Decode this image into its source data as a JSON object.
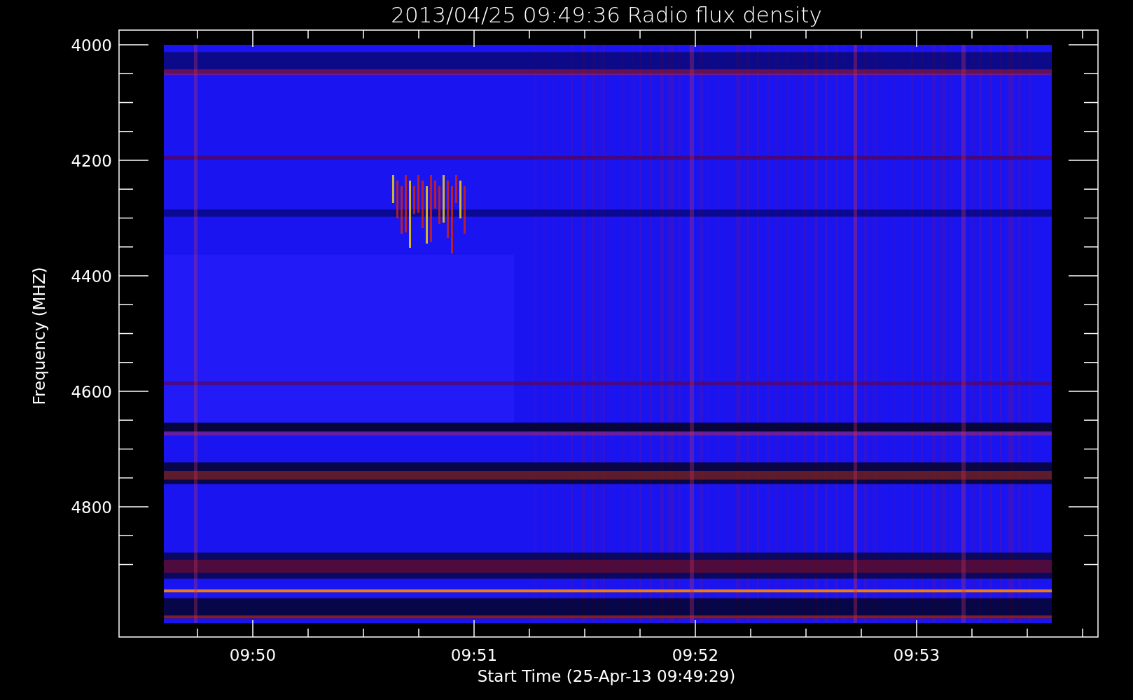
{
  "title": "2013/04/25 09:49:36 Radio flux density",
  "y_axis": {
    "label": "Frequency (MHZ)",
    "ticks": [
      "4000",
      "4200",
      "4400",
      "4600",
      "4800"
    ]
  },
  "x_axis": {
    "label": "Start Time (25-Apr-13 09:49:29)",
    "ticks": [
      "09:50",
      "09:51",
      "09:52",
      "09:53"
    ]
  }
}
